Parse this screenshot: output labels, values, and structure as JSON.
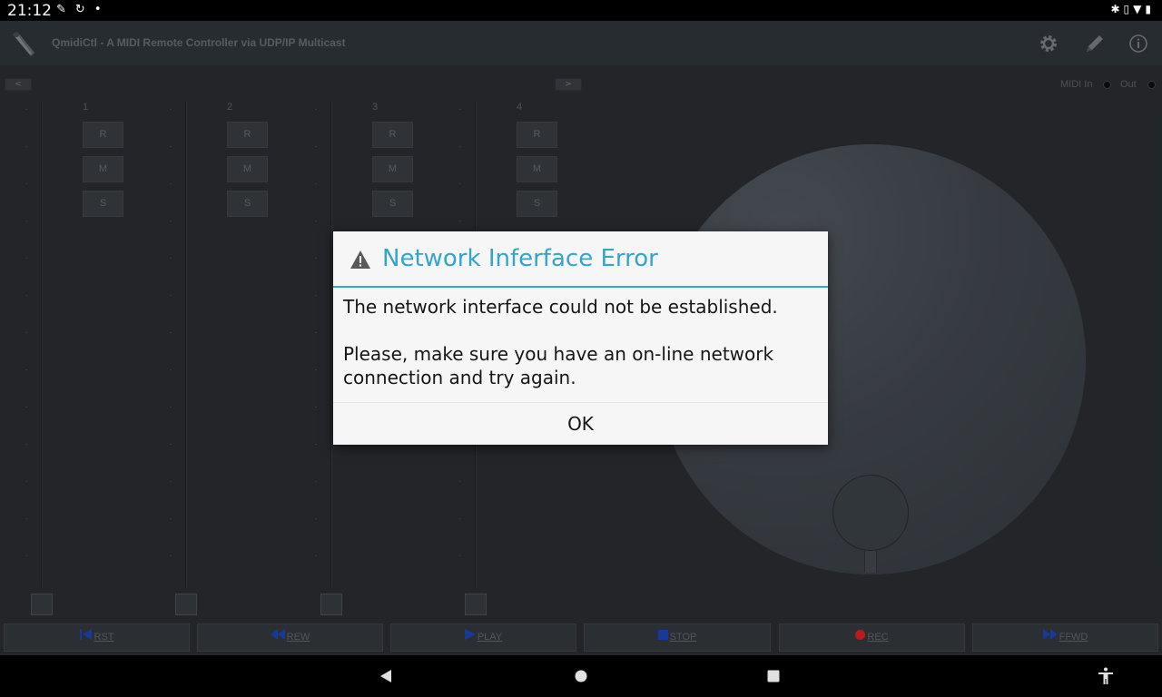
{
  "status": {
    "time": "21:12",
    "left_icons": [
      "notification-icon",
      "rotate-icon",
      "dot-icon"
    ],
    "right_icons": [
      "bluetooth-icon",
      "vibrate-icon",
      "wifi-icon",
      "battery-icon"
    ]
  },
  "appbar": {
    "title": "QmidiCtl - A MIDI Remote Controller via UDP/IP Multicast",
    "actions": [
      "settings-icon",
      "edit-icon",
      "info-icon"
    ]
  },
  "nav": {
    "prev": "<",
    "next": ">"
  },
  "midi": {
    "in_label": "MIDI In",
    "out_label": "Out"
  },
  "strips": [
    {
      "number": "1",
      "buttons": [
        "R",
        "M",
        "S"
      ]
    },
    {
      "number": "2",
      "buttons": [
        "R",
        "M",
        "S"
      ]
    },
    {
      "number": "3",
      "buttons": [
        "R",
        "M",
        "S"
      ]
    },
    {
      "number": "4",
      "buttons": [
        "R",
        "M",
        "S"
      ]
    }
  ],
  "transport": [
    {
      "label": "RST",
      "icon": "rewind-to-start-icon",
      "icon_color": "#1a3fa8"
    },
    {
      "label": "REW",
      "icon": "rewind-icon",
      "icon_color": "#1a3fa8"
    },
    {
      "label": "PLAY",
      "icon": "play-icon",
      "icon_color": "#1a3fa8"
    },
    {
      "label": "STOP",
      "icon": "stop-icon",
      "icon_color": "#1a3fa8"
    },
    {
      "label": "REC",
      "icon": "record-icon",
      "icon_color": "#c81e1e"
    },
    {
      "label": "FFWD",
      "icon": "fast-forward-icon",
      "icon_color": "#1a3fa8"
    }
  ],
  "dialog": {
    "title": "Network Inferface Error",
    "message": "The network interface could not be established.\n\nPlease, make sure you have an on-line network connection and try again.",
    "ok_label": "OK",
    "accent": "#35a9cf"
  },
  "navbar": [
    "back-icon",
    "home-icon",
    "recents-icon",
    "accessibility-icon"
  ]
}
